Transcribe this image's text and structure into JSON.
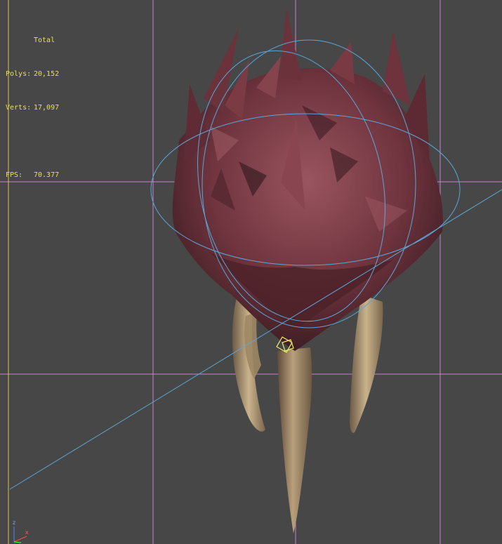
{
  "viewport_stats": {
    "header": "Total",
    "polys_label": "Polys:",
    "polys_value": "20,152",
    "verts_label": "Verts:",
    "verts_value": "17,097",
    "fps_label": "FPS:",
    "fps_value": "70.377"
  },
  "axis_tripod": {
    "z_label": "z",
    "x_label": "x"
  },
  "colors": {
    "background": "#474747",
    "grid_line": "#e38be6",
    "stats_text": "#e6e24a",
    "gizmo_circle": "#5aa7d8",
    "model_flesh": "#7a3c46",
    "model_tusk": "#b59d78",
    "light_gizmo": "#f2ec6a",
    "y_axis_line": "#d8c640"
  }
}
